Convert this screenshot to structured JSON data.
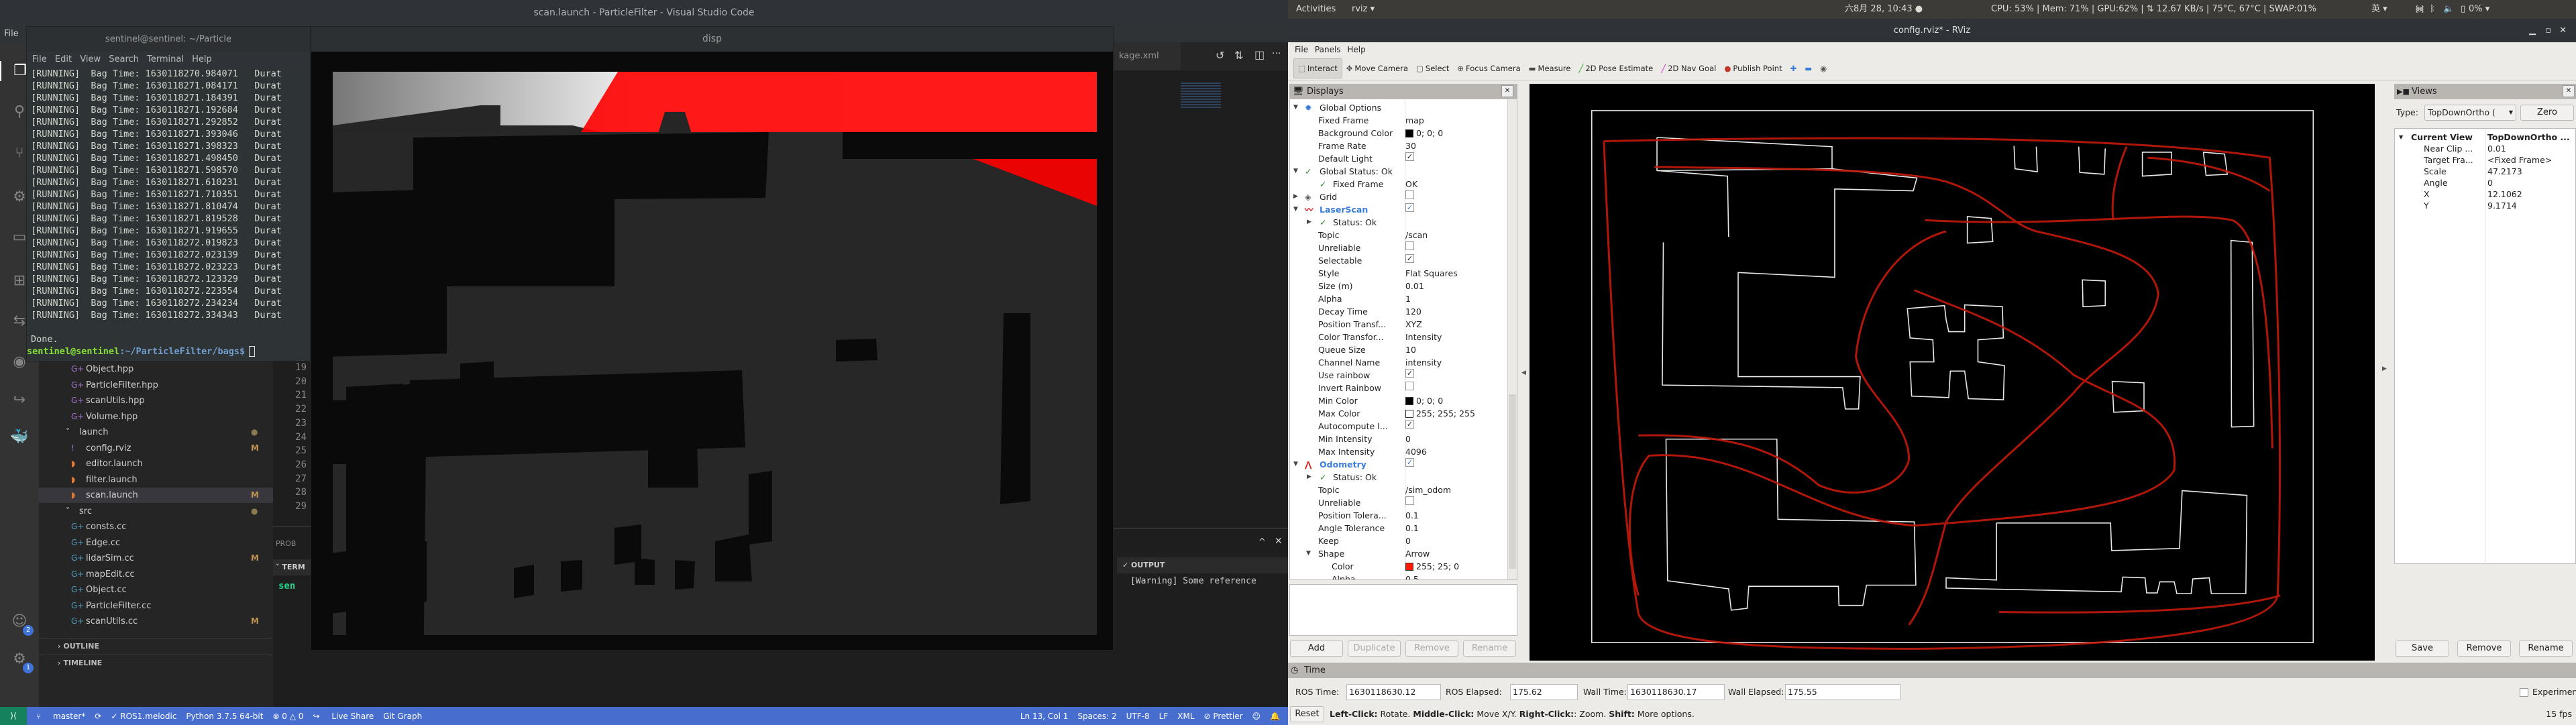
{
  "vscode": {
    "title": "scan.launch - ParticleFilter - Visual Studio Code",
    "menu": "File",
    "activity": [
      {
        "name": "explorer-icon",
        "glyph": "❐",
        "active": true
      },
      {
        "name": "search-icon",
        "glyph": "⚲"
      },
      {
        "name": "source-control-icon",
        "glyph": "⑂"
      },
      {
        "name": "debug-icon",
        "glyph": "⚙"
      },
      {
        "name": "remote-explorer-icon",
        "glyph": "▭"
      },
      {
        "name": "extensions-icon",
        "glyph": "⊞"
      },
      {
        "name": "timeline-icon",
        "glyph": "⇆"
      },
      {
        "name": "github-icon",
        "glyph": "◉"
      },
      {
        "name": "live-share-icon",
        "glyph": "↪"
      },
      {
        "name": "docker-icon",
        "glyph": "🐳"
      },
      {
        "name": "accounts-icon",
        "glyph": "☺",
        "badge": "2"
      },
      {
        "name": "settings-gear-icon",
        "glyph": "⚙",
        "badge": "1"
      }
    ],
    "explorer": [
      {
        "label": "Object.hpp",
        "type": "cpp"
      },
      {
        "label": "ParticleFilter.hpp",
        "type": "cpp"
      },
      {
        "label": "scanUtils.hpp",
        "type": "cpp"
      },
      {
        "label": "Volume.hpp",
        "type": "cpp"
      },
      {
        "label": "launch",
        "type": "folder"
      },
      {
        "label": "config.rviz",
        "type": "rviz",
        "status": "M"
      },
      {
        "label": "editor.launch",
        "type": "launch"
      },
      {
        "label": "filter.launch",
        "type": "launch"
      },
      {
        "label": "scan.launch",
        "type": "launch",
        "status": "M",
        "selected": true
      },
      {
        "label": "src",
        "type": "folder"
      },
      {
        "label": "consts.cc",
        "type": "cc"
      },
      {
        "label": "Edge.cc",
        "type": "cc"
      },
      {
        "label": "lidarSim.cc",
        "type": "cc",
        "status": "M"
      },
      {
        "label": "mapEdit.cc",
        "type": "cc"
      },
      {
        "label": "Object.cc",
        "type": "cc"
      },
      {
        "label": "ParticleFilter.cc",
        "type": "cc"
      },
      {
        "label": "scanUtils.cc",
        "type": "cc",
        "status": "M"
      }
    ],
    "sections": [
      "OUTLINE",
      "TIMELINE"
    ],
    "line_numbers": [
      "19",
      "20",
      "21",
      "22",
      "23",
      "24",
      "25",
      "26",
      "27",
      "28",
      "29"
    ],
    "tab_label": "kage.xml",
    "panel": {
      "problems_tab": "PROB",
      "terminal_header": "TERM",
      "terminal_text": "sen",
      "output_header": "OUTPUT",
      "output_text": "[Warning] Some reference"
    },
    "statusbar": {
      "branch": "master*",
      "ros": "✓ ROS1.melodic",
      "python": "Python 3.7.5 64-bit",
      "errors": "⊗ 0 △ 0",
      "liveshare": "Live Share",
      "gitgraph": "Git Graph",
      "position": "Ln 13, Col 1",
      "spaces": "Spaces: 2",
      "encoding": "UTF-8",
      "eol": "LF",
      "language": "XML",
      "prettier": "⊘ Prettier"
    }
  },
  "terminal": {
    "title": "sentinel@sentinel: ~/Particle",
    "menu": [
      "File",
      "Edit",
      "View",
      "Search",
      "Terminal",
      "Help"
    ],
    "lines": [
      "[RUNNING]  Bag Time: 1630118270.984071   Durat",
      "[RUNNING]  Bag Time: 1630118271.084171   Durat",
      "[RUNNING]  Bag Time: 1630118271.184391   Durat",
      "[RUNNING]  Bag Time: 1630118271.192684   Durat",
      "[RUNNING]  Bag Time: 1630118271.292852   Durat",
      "[RUNNING]  Bag Time: 1630118271.393046   Durat",
      "[RUNNING]  Bag Time: 1630118271.398323   Durat",
      "[RUNNING]  Bag Time: 1630118271.498450   Durat",
      "[RUNNING]  Bag Time: 1630118271.598570   Durat",
      "[RUNNING]  Bag Time: 1630118271.610231   Durat",
      "[RUNNING]  Bag Time: 1630118271.710351   Durat",
      "[RUNNING]  Bag Time: 1630118271.810474   Durat",
      "[RUNNING]  Bag Time: 1630118271.819528   Durat",
      "[RUNNING]  Bag Time: 1630118271.919655   Durat",
      "[RUNNING]  Bag Time: 1630118272.019823   Durat",
      "[RUNNING]  Bag Time: 1630118272.023139   Durat",
      "[RUNNING]  Bag Time: 1630118272.023223   Durat",
      "[RUNNING]  Bag Time: 1630118272.123329   Durat",
      "[RUNNING]  Bag Time: 1630118272.223554   Durat",
      "[RUNNING]  Bag Time: 1630118272.234234   Durat",
      "[RUNNING]  Bag Time: 1630118272.334343   Durat",
      "",
      "Done."
    ],
    "prompt_user": "sentinel@sentinel",
    "prompt_path": ":~/ParticleFilter/bags$"
  },
  "disp": {
    "title": "disp"
  },
  "ubuntu": {
    "activities": "Activities",
    "app": "rviz ▾",
    "clock": "六8月 28, 10:43 ●",
    "stats": "CPU: 53% | Mem: 71% | GPU:62% | ⇅ 12.67 KB/s | 75°C, 67°C | SWAP:01%",
    "ime": "英 ▾",
    "battery": "0% ▾"
  },
  "rviz": {
    "title": "config.rviz* - RViz",
    "menu": [
      "File",
      "Panels",
      "Help"
    ],
    "tools": [
      {
        "label": "Interact",
        "icon": "cursor-icon",
        "glyph": "⬚",
        "active": true
      },
      {
        "label": "Move Camera",
        "icon": "move-camera-icon",
        "glyph": "✥"
      },
      {
        "label": "Select",
        "icon": "select-icon",
        "glyph": "▢"
      },
      {
        "label": "Focus Camera",
        "icon": "focus-camera-icon",
        "glyph": "⊕"
      },
      {
        "label": "Measure",
        "icon": "measure-icon",
        "glyph": "▬"
      },
      {
        "label": "2D Pose Estimate",
        "icon": "pose-estimate-icon",
        "glyph": "╱",
        "color": "#22aa22"
      },
      {
        "label": "2D Nav Goal",
        "icon": "nav-goal-icon",
        "glyph": "╱",
        "color": "#cc22cc"
      },
      {
        "label": "Publish Point",
        "icon": "publish-point-icon",
        "glyph": "●",
        "color": "#c0392b"
      },
      {
        "label": "",
        "icon": "add-tool-icon",
        "glyph": "✚",
        "color": "#3a7bd5"
      },
      {
        "label": "",
        "icon": "remove-tool-icon",
        "glyph": "▬",
        "color": "#3a7bd5"
      },
      {
        "label": "",
        "icon": "tool-properties-icon",
        "glyph": "◉",
        "color": "#555"
      }
    ],
    "displays": {
      "title": "Displays",
      "rows": [
        {
          "k": "Global Options",
          "lvl": 0,
          "arrow": "▼",
          "icon": "gear-icon",
          "iconGlyph": "✹",
          "iconColor": "#3a7bd5"
        },
        {
          "k": "Fixed Frame",
          "v": "map",
          "lvl": 1
        },
        {
          "k": "Background Color",
          "v": "0; 0; 0",
          "swatch": "#000000",
          "lvl": 1
        },
        {
          "k": "Frame Rate",
          "v": "30",
          "lvl": 1
        },
        {
          "k": "Default Light",
          "check": true,
          "lvl": 1
        },
        {
          "k": "Global Status: Ok",
          "lvl": 0,
          "arrow": "▼",
          "icon": "status-ok-icon",
          "iconGlyph": "✓",
          "iconColor": "#2e8b2e"
        },
        {
          "k": "Fixed Frame",
          "v": "OK",
          "lvl": 2,
          "icon": "status-ok-icon",
          "iconGlyph": "✓",
          "iconColor": "#2e8b2e"
        },
        {
          "k": "Grid",
          "lvl": 0,
          "arrow": "▶",
          "icon": "grid-icon",
          "iconGlyph": "◈",
          "iconColor": "#555",
          "check": false
        },
        {
          "k": "LaserScan",
          "lvl": 0,
          "arrow": "▼",
          "icon": "laserscan-icon",
          "iconGlyph": "〰",
          "iconColor": "#dd1111",
          "check": true,
          "hl": true
        },
        {
          "k": "Status: Ok",
          "lvl": 2,
          "arrow2": "▶",
          "icon": "status-ok-icon",
          "iconGlyph": "✓",
          "iconColor": "#2e8b2e"
        },
        {
          "k": "Topic",
          "v": "/scan",
          "lvl": 1
        },
        {
          "k": "Unreliable",
          "check": false,
          "lvl": 1
        },
        {
          "k": "Selectable",
          "check": true,
          "lvl": 1
        },
        {
          "k": "Style",
          "v": "Flat Squares",
          "lvl": 1
        },
        {
          "k": "Size (m)",
          "v": "0.01",
          "lvl": 1
        },
        {
          "k": "Alpha",
          "v": "1",
          "lvl": 1
        },
        {
          "k": "Decay Time",
          "v": "120",
          "lvl": 1
        },
        {
          "k": "Position Transf...",
          "v": "XYZ",
          "lvl": 1
        },
        {
          "k": "Color Transfor...",
          "v": "Intensity",
          "lvl": 1
        },
        {
          "k": "Queue Size",
          "v": "10",
          "lvl": 1
        },
        {
          "k": "Channel Name",
          "v": "intensity",
          "lvl": 1
        },
        {
          "k": "Use rainbow",
          "check": true,
          "lvl": 1
        },
        {
          "k": "Invert Rainbow",
          "check": false,
          "lvl": 1
        },
        {
          "k": "Min Color",
          "v": "0; 0; 0",
          "swatch": "#000000",
          "lvl": 1
        },
        {
          "k": "Max Color",
          "v": "255; 255; 255",
          "swatch": "#ffffff",
          "lvl": 1
        },
        {
          "k": "Autocompute I...",
          "check": true,
          "lvl": 1
        },
        {
          "k": "Min Intensity",
          "v": "0",
          "lvl": 1
        },
        {
          "k": "Max Intensity",
          "v": "4096",
          "lvl": 1
        },
        {
          "k": "Odometry",
          "lvl": 0,
          "arrow": "▼",
          "icon": "odometry-icon",
          "iconGlyph": "⋀",
          "iconColor": "#dd1111",
          "check": true,
          "hl": true
        },
        {
          "k": "Status: Ok",
          "lvl": 2,
          "arrow2": "▶",
          "icon": "status-ok-icon",
          "iconGlyph": "✓",
          "iconColor": "#2e8b2e"
        },
        {
          "k": "Topic",
          "v": "/sim_odom",
          "lvl": 1
        },
        {
          "k": "Unreliable",
          "check": false,
          "lvl": 1
        },
        {
          "k": "Position Tolera...",
          "v": "0.1",
          "lvl": 1
        },
        {
          "k": "Angle Tolerance",
          "v": "0.1",
          "lvl": 1
        },
        {
          "k": "Keep",
          "v": "0",
          "lvl": 1
        },
        {
          "k": "Shape",
          "v": "Arrow",
          "lvl": 1,
          "arrow2": "▼"
        },
        {
          "k": "Color",
          "v": "255; 25; 0",
          "swatch": "#ff1900",
          "lvl": 3
        },
        {
          "k": "Alpha",
          "v": "0.5",
          "lvl": 3
        }
      ],
      "buttons": {
        "add": "Add",
        "duplicate": "Duplicate",
        "remove": "Remove",
        "rename": "Rename"
      }
    },
    "views": {
      "title": "Views",
      "type_label": "Type:",
      "type_value": "TopDownOrtho (",
      "zero": "Zero",
      "rows": [
        {
          "k": "Current View",
          "v": "TopDownOrtho ...",
          "bold": true
        },
        {
          "k": "Near Clip ...",
          "v": "0.01"
        },
        {
          "k": "Target Fra...",
          "v": "<Fixed Frame>"
        },
        {
          "k": "Scale",
          "v": "47.2173"
        },
        {
          "k": "Angle",
          "v": "0"
        },
        {
          "k": "X",
          "v": "12.1062"
        },
        {
          "k": "Y",
          "v": "9.1714"
        }
      ],
      "buttons": {
        "save": "Save",
        "remove": "Remove",
        "rename": "Rename"
      }
    },
    "time": {
      "title": "Time",
      "ros_time_label": "ROS Time:",
      "ros_time": "1630118630.12",
      "ros_elapsed_label": "ROS Elapsed:",
      "ros_elapsed": "175.62",
      "wall_time_label": "Wall Time:",
      "wall_time": "1630118630.17",
      "wall_elapsed_label": "Wall Elapsed:",
      "wall_elapsed": "175.55",
      "experimental": "Experimental"
    },
    "status": {
      "reset": "Reset",
      "help_b1": "Left-Click:",
      "help_t1": " Rotate. ",
      "help_b2": "Middle-Click:",
      "help_t2": " Move X/Y. ",
      "help_b3": "Right-Click:",
      "help_t3": ": Zoom. ",
      "help_b4": "Shift:",
      "help_t4": " More options.",
      "fps": "15 fps"
    }
  }
}
